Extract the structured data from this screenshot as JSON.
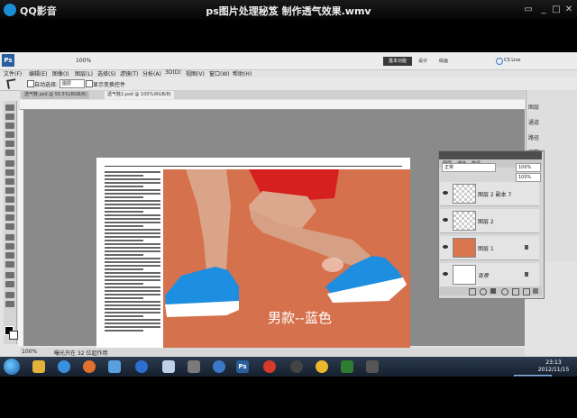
{
  "player": {
    "app_name": "QQ影音",
    "file_title": "ps图片处理秘笈 制作透气效果.wmv"
  },
  "photoshop": {
    "menu": [
      "文件(F)",
      "编辑(E)",
      "图像(I)",
      "图层(L)",
      "选择(S)",
      "滤镜(T)",
      "分析(A)",
      "3D(D)",
      "视图(V)",
      "窗口(W)",
      "帮助(H)"
    ],
    "workspace_buttons": [
      "基本功能",
      "设计",
      "绘画"
    ],
    "cs_live": "CS Live",
    "options": {
      "auto_select": "自动选择:",
      "auto_select_value": "图层",
      "transform_controls": "显示变换控件"
    },
    "doc_tabs": [
      "透气鞋.psd @ 55.5%(RGB/8)",
      "透气鞋2.psd @ 100%(RGB/8)"
    ],
    "zoom": "100%",
    "status_doc": "曝光只在 32 位起作用",
    "caption": "男款--蓝色",
    "dock": [
      "图层",
      "通道",
      "路径",
      "调整",
      "蒙版"
    ],
    "layers": {
      "tabs": [
        "图层",
        "通道",
        "路径"
      ],
      "blend_mode": "正常",
      "opacity": "100%",
      "fill": "100%",
      "items": [
        {
          "name": "图层 2 副本 7",
          "type": "checker"
        },
        {
          "name": "图层 2",
          "type": "checker"
        },
        {
          "name": "图层 1",
          "type": "photo"
        },
        {
          "name": "背景",
          "type": "white"
        }
      ]
    }
  },
  "taskbar": {
    "time": "23:13",
    "date": "2012/11/15"
  },
  "colors": {
    "shoe_blue": "#1e8ee0",
    "track": "#d9744f",
    "shorts": "#d61f1f"
  }
}
